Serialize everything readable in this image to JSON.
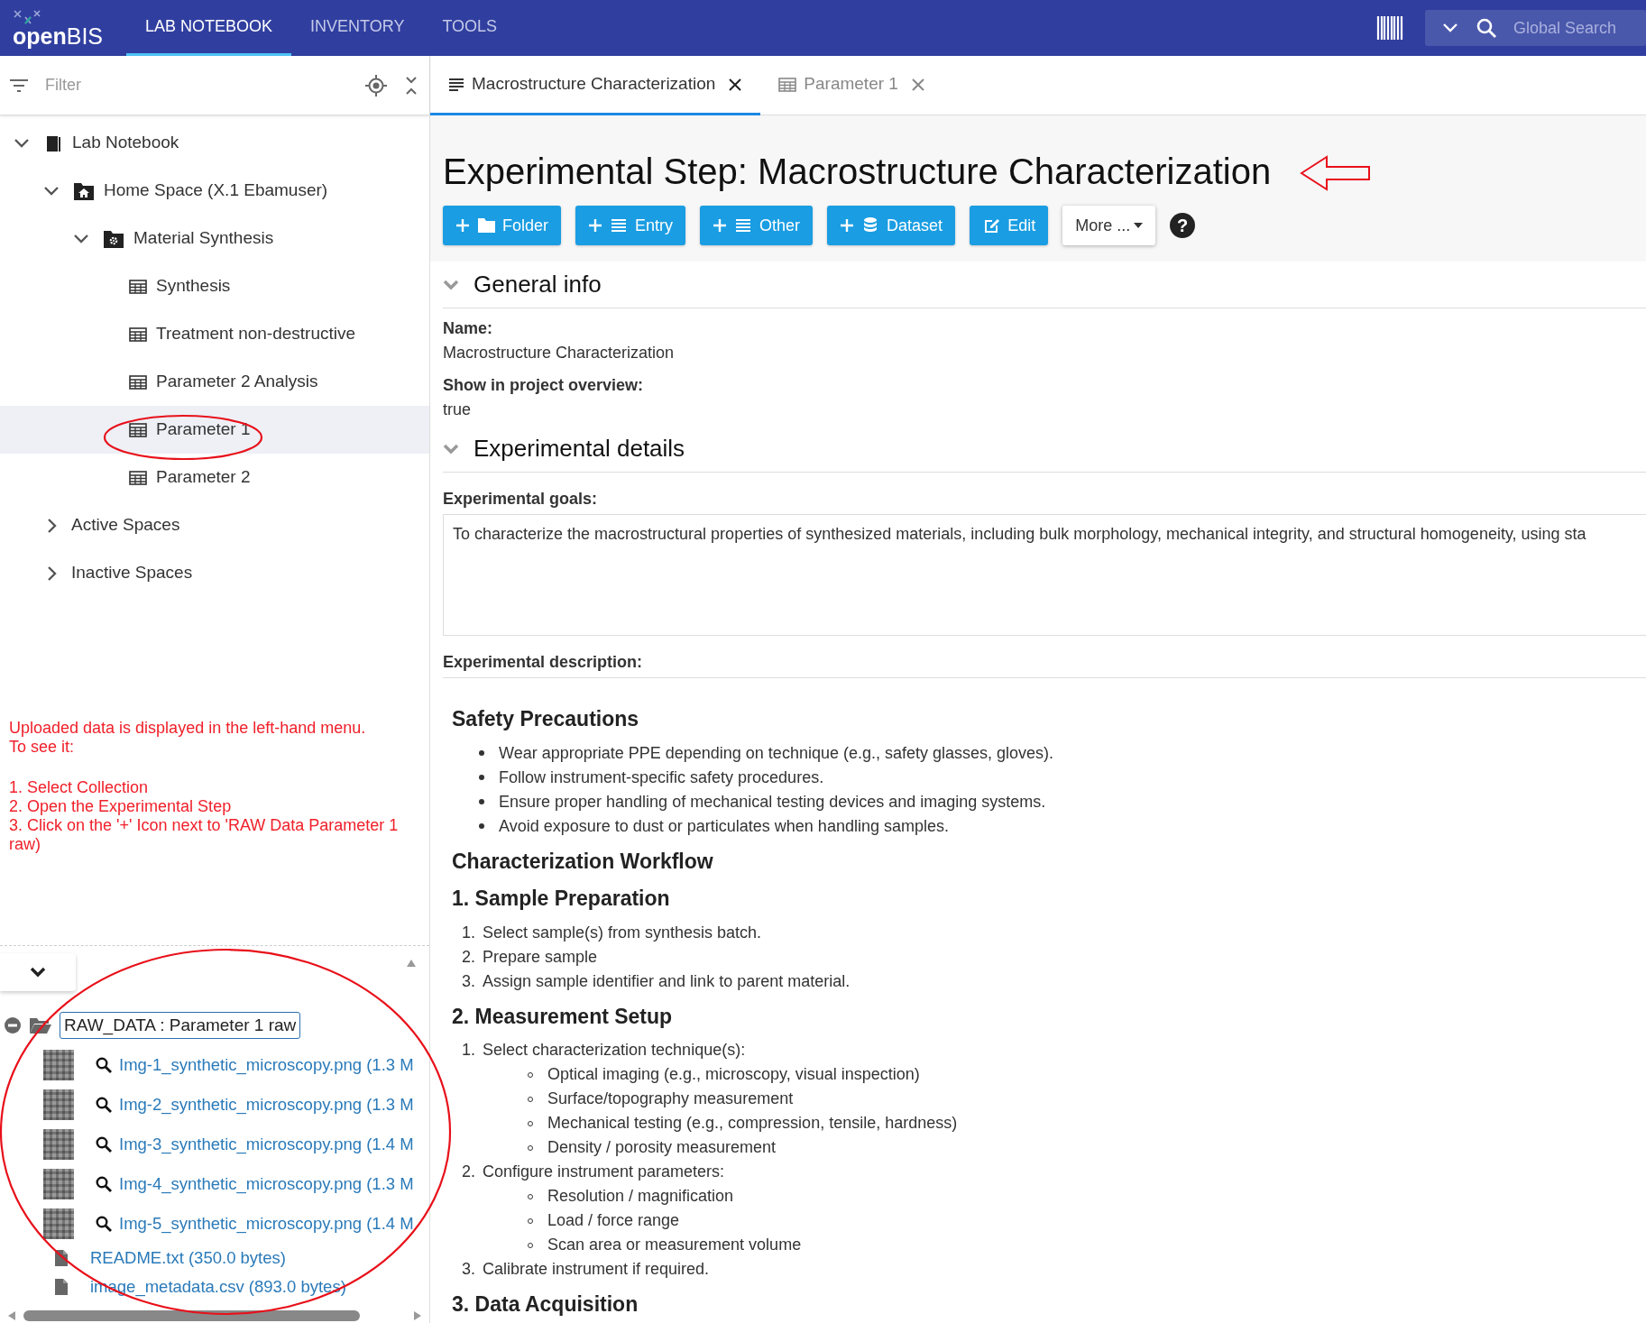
{
  "navbar": {
    "logo": "**open**BIS",
    "tabs": [
      {
        "label": "LAB NOTEBOOK",
        "selected": true
      },
      {
        "label": "INVENTORY",
        "selected": false
      },
      {
        "label": "TOOLS",
        "selected": false
      }
    ],
    "search": {
      "placeholder": "Global Search"
    }
  },
  "sidebar": {
    "filter": {
      "placeholder": "Filter"
    },
    "tree": [
      {
        "label": "Lab Notebook",
        "kind": "notebook",
        "expanded": true,
        "selected": false,
        "children": [
          {
            "label": "Home Space (X.1 Ebamuser)",
            "kind": "space",
            "expanded": true,
            "selected": false,
            "children": [
              {
                "label": "Material Synthesis",
                "kind": "project",
                "expanded": true,
                "selected": false,
                "children": [
                  {
                    "label": "Synthesis",
                    "kind": "collection",
                    "selected": false
                  },
                  {
                    "label": "Treatment non-destructive",
                    "kind": "collection",
                    "selected": false
                  },
                  {
                    "label": "Parameter 2 Analysis",
                    "kind": "collection",
                    "selected": false
                  },
                  {
                    "label": "Parameter 1",
                    "kind": "collection",
                    "selected": true
                  },
                  {
                    "label": "Parameter 2",
                    "kind": "collection",
                    "selected": false
                  }
                ]
              }
            ]
          },
          {
            "label": "Active Spaces",
            "kind": "group",
            "expanded": false,
            "selected": false
          },
          {
            "label": "Inactive Spaces",
            "kind": "group",
            "expanded": false,
            "selected": false
          }
        ]
      }
    ],
    "note": {
      "intro": "Uploaded data is displayed in the left-hand menu.\nTo see it:",
      "steps": [
        "1. Select Collection",
        "2. Open the Experimental Step",
        "3. Click on the '+' Icon next to 'RAW Data Parameter 1 raw)"
      ]
    },
    "datasets": {
      "panel_expanded": true,
      "dataset": {
        "label": "RAW_DATA : Parameter 1 raw",
        "expanded": true,
        "files": [
          {
            "kind": "image",
            "name": "Img-1_synthetic_microscopy.png (1.3 M"
          },
          {
            "kind": "image",
            "name": "Img-2_synthetic_microscopy.png (1.3 M"
          },
          {
            "kind": "image",
            "name": "Img-3_synthetic_microscopy.png (1.4 M"
          },
          {
            "kind": "image",
            "name": "Img-4_synthetic_microscopy.png (1.3 M"
          },
          {
            "kind": "image",
            "name": "Img-5_synthetic_microscopy.png (1.4 M"
          },
          {
            "kind": "file",
            "name": "README.txt (350.0 bytes)"
          },
          {
            "kind": "file",
            "name": "image_metadata.csv (893.0 bytes)"
          }
        ]
      }
    }
  },
  "tabs": [
    {
      "label": "Macrostructure Characterization",
      "kind": "entry",
      "selected": true
    },
    {
      "label": "Parameter 1",
      "kind": "collection",
      "selected": false
    }
  ],
  "main": {
    "title": "Experimental Step: Macrostructure Characterization",
    "buttons": [
      {
        "label": "Folder",
        "kind": "folder"
      },
      {
        "label": "Entry",
        "kind": "entry"
      },
      {
        "label": "Other",
        "kind": "other"
      },
      {
        "label": "Dataset",
        "kind": "dataset"
      },
      {
        "label": "Edit",
        "kind": "edit"
      },
      {
        "label": "More ...",
        "kind": "dropdown"
      }
    ],
    "help": "?",
    "general_info": {
      "title": "General info",
      "expanded": true,
      "fields": [
        {
          "label": "Name:",
          "value": "Macrostructure Characterization"
        },
        {
          "label": "Show in project overview:",
          "value": "true"
        }
      ]
    },
    "experimental_details": {
      "title": "Experimental details",
      "expanded": true,
      "goals": {
        "label": "Experimental goals:",
        "value": "To characterize the macrostructural properties of synthesized materials, including bulk morphology, mechanical integrity, and structural homogeneity, using sta"
      },
      "description": {
        "label": "Experimental description:",
        "blocks": [
          {
            "kind": "heading",
            "text": "Safety Precautions"
          },
          {
            "kind": "bullets",
            "items": [
              {
                "text": "Wear appropriate PPE depending on technique (e.g., safety glasses, gloves)."
              },
              {
                "text": "Follow instrument-specific safety procedures."
              },
              {
                "text": "Ensure proper handling of mechanical testing devices and imaging systems."
              },
              {
                "text": "Avoid exposure to dust or particulates when handling samples."
              }
            ]
          },
          {
            "kind": "heading",
            "text": "Characterization Workflow"
          },
          {
            "kind": "heading",
            "text": "1. Sample Preparation"
          },
          {
            "kind": "numbered",
            "items": [
              {
                "number": "1.",
                "text": "Select sample(s) from synthesis batch."
              },
              {
                "number": "2.",
                "text": "Prepare sample"
              },
              {
                "number": "3.",
                "text": "Assign sample identifier and link to parent material."
              }
            ]
          },
          {
            "kind": "heading",
            "text": "2. Measurement Setup"
          },
          {
            "kind": "numbered",
            "items": [
              {
                "number": "1.",
                "text": "Select characterization technique(s):",
                "children": [
                  "Optical imaging (e.g., microscopy, visual inspection)",
                  "Surface/topography measurement",
                  "Mechanical testing (e.g., compression, tensile, hardness)",
                  "Density / porosity measurement"
                ]
              },
              {
                "number": "2.",
                "text": "Configure instrument parameters:",
                "children": [
                  "Resolution / magnification",
                  "Load / force range",
                  "Scan area or measurement volume"
                ]
              },
              {
                "number": "3.",
                "text": "Calibrate instrument if required."
              }
            ]
          },
          {
            "kind": "heading",
            "text": "3. Data Acquisition"
          }
        ]
      }
    }
  }
}
